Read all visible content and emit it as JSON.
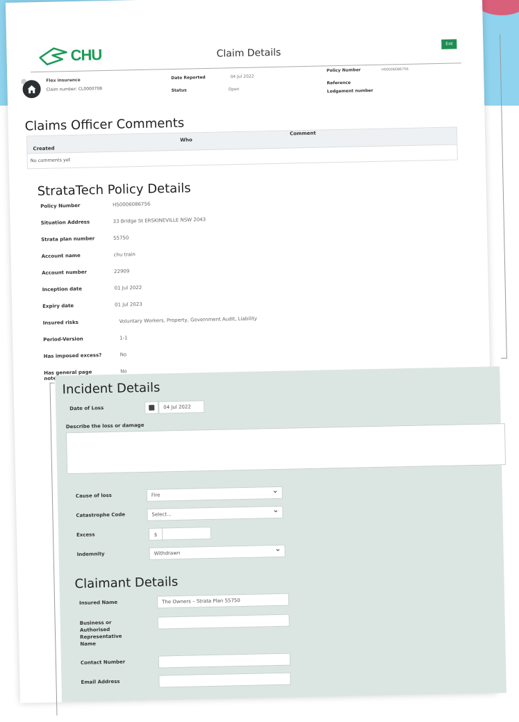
{
  "header": {
    "logo_text": "CHU",
    "page_title": "Claim Details",
    "exit_label": "Exit"
  },
  "claim": {
    "insurer": "Flex insurance",
    "claim_number": "Claim number: CL0000708",
    "date_reported_label": "Date Reported",
    "date_reported_value": "04 Jul 2022",
    "status_label": "Status",
    "status_value": "Open",
    "policy_number_label": "Policy Number",
    "policy_number_value": "HS0006086756",
    "reference_label": "Reference",
    "lodgement_label": "Lodgement number"
  },
  "comments": {
    "title": "Claims Officer Comments",
    "columns": [
      "Created",
      "Who",
      "Comment"
    ],
    "empty_text": "No comments yet"
  },
  "policy": {
    "title": "StrataTech Policy Details",
    "rows": [
      {
        "label": "Policy Number",
        "value": "HS0006086756"
      },
      {
        "label": "Situation Address",
        "value": "33 Bridge St ERSKINEVILLE NSW 2043"
      },
      {
        "label": "Strata plan number",
        "value": "55750"
      },
      {
        "label": "Account name",
        "value": "chu train"
      },
      {
        "label": "Account number",
        "value": "22909"
      },
      {
        "label": "Inception date",
        "value": "01 Jul 2022"
      },
      {
        "label": "Expiry date",
        "value": "01 Jul 2023"
      },
      {
        "label": "Insured risks",
        "value": "Voluntary Workers, Property, Government Audit, Liability"
      },
      {
        "label": "Period-Version",
        "value": "1-1"
      },
      {
        "label": "Has imposed excess?",
        "value": "No"
      },
      {
        "label": "Has general page notes?",
        "value": "No"
      }
    ]
  },
  "incident": {
    "title": "Incident Details",
    "date_of_loss_label": "Date of Loss",
    "date_of_loss_value": "04 Jul 2022",
    "describe_label": "Describe the loss or damage",
    "cause_label": "Cause of loss",
    "cause_value": "Fire",
    "catastrophe_label": "Catastrophe Code",
    "catastrophe_value": "Select...",
    "excess_label": "Excess",
    "excess_prefix": "$",
    "indemnity_label": "Indemnity",
    "indemnity_value": "Withdrawn"
  },
  "claimant": {
    "title": "Claimant Details",
    "insured_name_label": "Insured Name",
    "insured_name_value": "The Owners – Strata Plan 55750",
    "business_label": "Business or Authorised Representative Name",
    "contact_label": "Contact Number",
    "email_label": "Email Address"
  }
}
